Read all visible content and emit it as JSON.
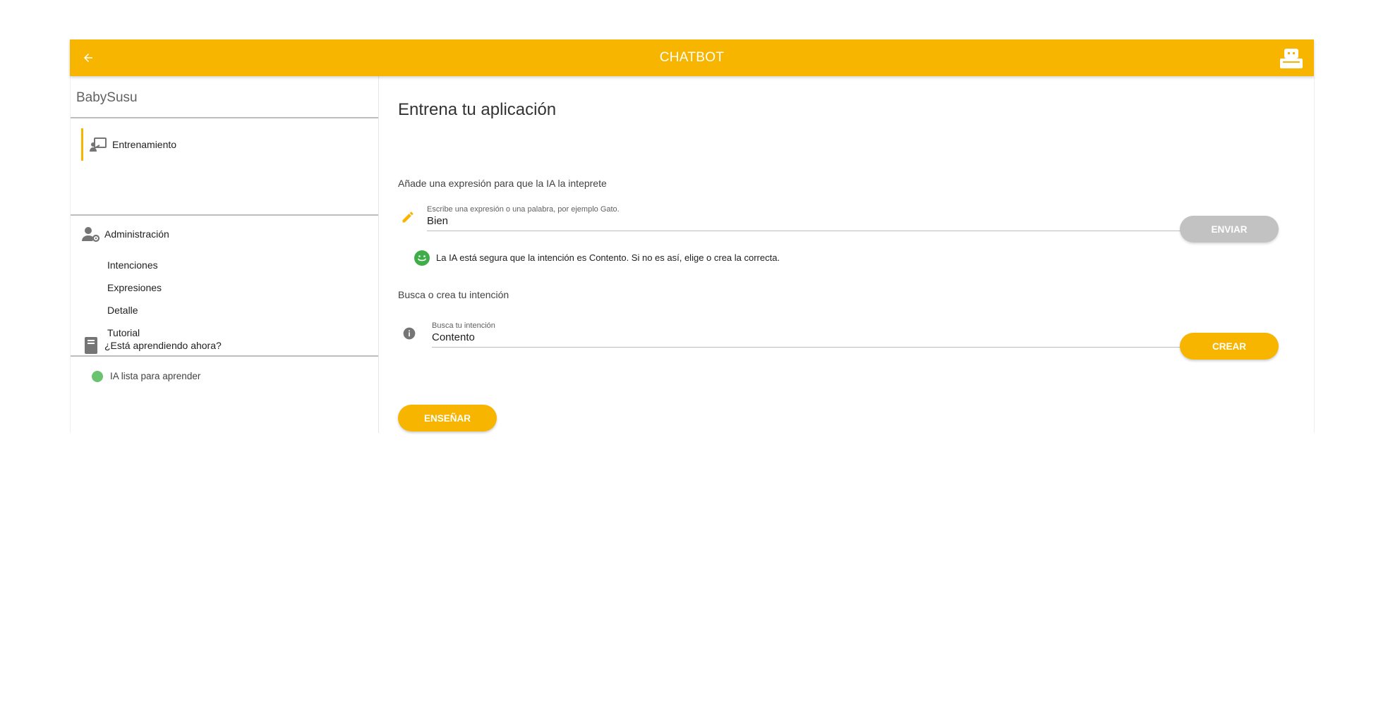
{
  "header": {
    "title": "CHATBOT",
    "back_icon": "arrow-left-icon",
    "robot_icon": "robot-icon",
    "color": "#f7b500"
  },
  "sidebar": {
    "app_name": "BabySusu",
    "training": {
      "label": "Entrenamiento",
      "icon": "teacher-board-icon",
      "active": true
    },
    "admin": {
      "label": "Administración",
      "icon": "user-gear-icon",
      "items": [
        {
          "label": "Intenciones"
        },
        {
          "label": "Expresiones"
        },
        {
          "label": "Detalle"
        },
        {
          "label": "Tutorial"
        }
      ]
    },
    "learning": {
      "label": "¿Está aprendiendo ahora?",
      "icon": "book-icon",
      "status": "IA lista para aprender",
      "status_color": "#6cc36f"
    }
  },
  "main": {
    "title": "Entrena tu aplicación",
    "expression_prompt": "Añade una expresión para que la IA la inteprete",
    "expression_field": {
      "label": "Escribe una expresión o una palabra, por ejemplo Gato.",
      "value": "Bien",
      "icon": "pencil-icon"
    },
    "send_button": "ENVIAR",
    "confidence_message": "La IA está segura que la intención es Contento. Si no es así, elige o crea la correcta.",
    "confidence_icon": "smile-icon",
    "intent_prompt": "Busca o crea tu intención",
    "intent_field": {
      "label": "Busca tu intención",
      "value": "Contento",
      "icon": "info-icon"
    },
    "create_button": "CREAR",
    "teach_button": "ENSEÑAR"
  }
}
